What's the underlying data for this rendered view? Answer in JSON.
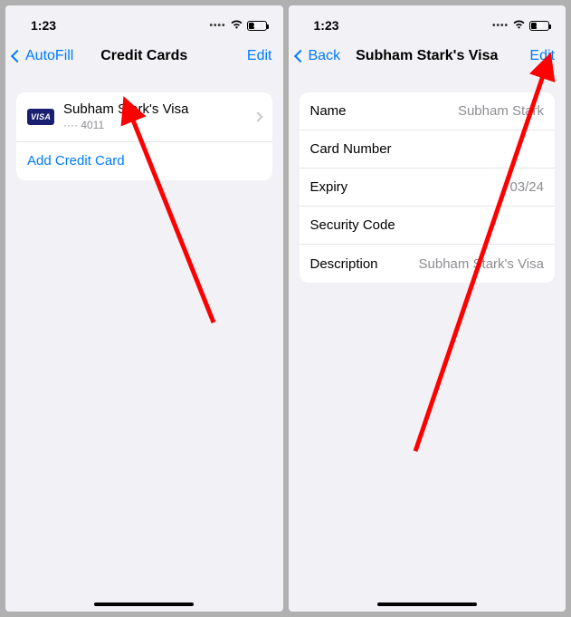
{
  "left": {
    "status_time": "1:23",
    "battery_percent": "32",
    "back_label": "AutoFill",
    "title": "Credit Cards",
    "edit_label": "Edit",
    "card": {
      "badge": "VISA",
      "name": "Subham Stark's Visa",
      "number_masked": "···· 4011"
    },
    "add_label": "Add Credit Card"
  },
  "right": {
    "status_time": "1:23",
    "battery_percent": "32",
    "back_label": "Back",
    "title": "Subham Stark's Visa",
    "edit_label": "Edit",
    "rows": {
      "name_label": "Name",
      "name_value": "Subham Stark",
      "number_label": "Card Number",
      "number_value": "",
      "expiry_label": "Expiry",
      "expiry_value": "03/24",
      "security_label": "Security Code",
      "security_value": "",
      "description_label": "Description",
      "description_value": "Subham Stark's Visa"
    }
  }
}
